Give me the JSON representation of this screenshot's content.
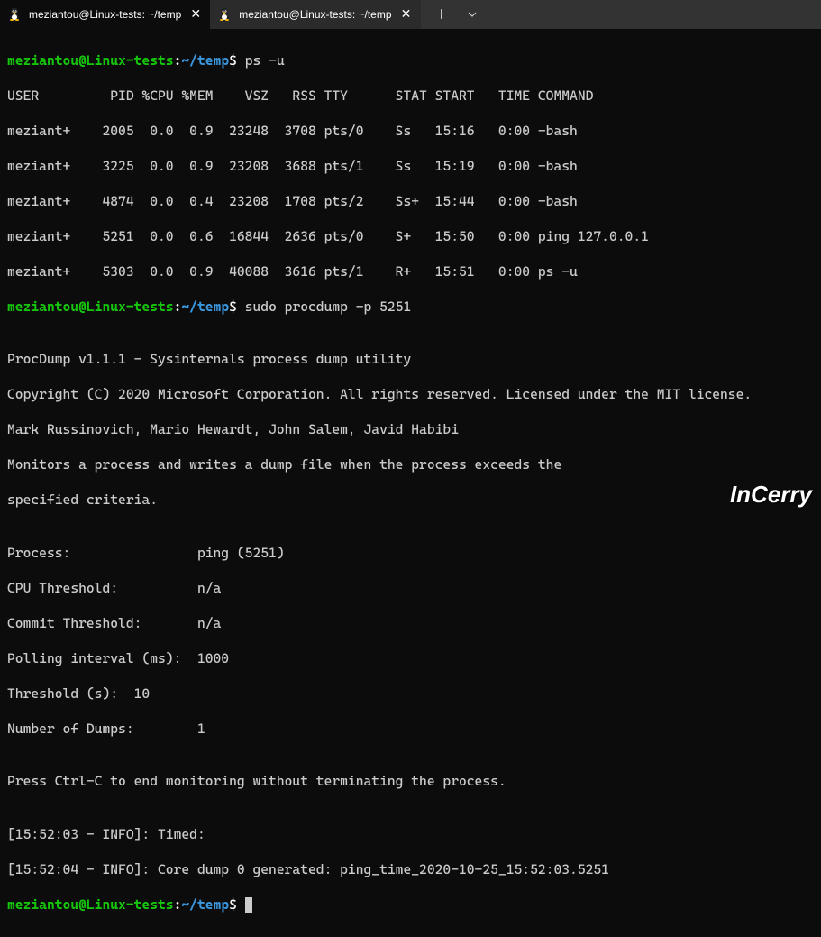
{
  "tabs": [
    {
      "title": "meziantou@Linux-tests: ~/temp",
      "active": true
    },
    {
      "title": "meziantou@Linux-tests: ~/temp",
      "active": false
    }
  ],
  "prompt": {
    "user_host": "meziantou@Linux-tests",
    "sep": ":",
    "path": "~/temp",
    "symbol": "$"
  },
  "cmd1": "ps -u",
  "ps_header": "USER         PID %CPU %MEM    VSZ   RSS TTY      STAT START   TIME COMMAND",
  "ps_rows": [
    "meziant+    2005  0.0  0.9  23248  3708 pts/0    Ss   15:16   0:00 -bash",
    "meziant+    3225  0.0  0.9  23208  3688 pts/1    Ss   15:19   0:00 -bash",
    "meziant+    4874  0.0  0.4  23208  1708 pts/2    Ss+  15:44   0:00 -bash",
    "meziant+    5251  0.0  0.6  16844  2636 pts/0    S+   15:50   0:00 ping 127.0.0.1",
    "meziant+    5303  0.0  0.9  40088  3616 pts/1    R+   15:51   0:00 ps -u"
  ],
  "cmd2": "sudo procdump -p 5251",
  "blank": "",
  "pd_lines": [
    "ProcDump v1.1.1 - Sysinternals process dump utility",
    "Copyright (C) 2020 Microsoft Corporation. All rights reserved. Licensed under the MIT license.",
    "Mark Russinovich, Mario Hewardt, John Salem, Javid Habibi",
    "Monitors a process and writes a dump file when the process exceeds the",
    "specified criteria."
  ],
  "cfg_lines": [
    "Process:                ping (5251)",
    "CPU Threshold:          n/a",
    "Commit Threshold:       n/a",
    "Polling interval (ms):  1000",
    "Threshold (s):  10",
    "Number of Dumps:        1"
  ],
  "hint": "Press Ctrl-C to end monitoring without terminating the process.",
  "log_lines": [
    "[15:52:03 - INFO]: Timed:",
    "[15:52:04 - INFO]: Core dump 0 generated: ping_time_2020-10-25_15:52:03.5251"
  ],
  "watermark": "InCerry"
}
